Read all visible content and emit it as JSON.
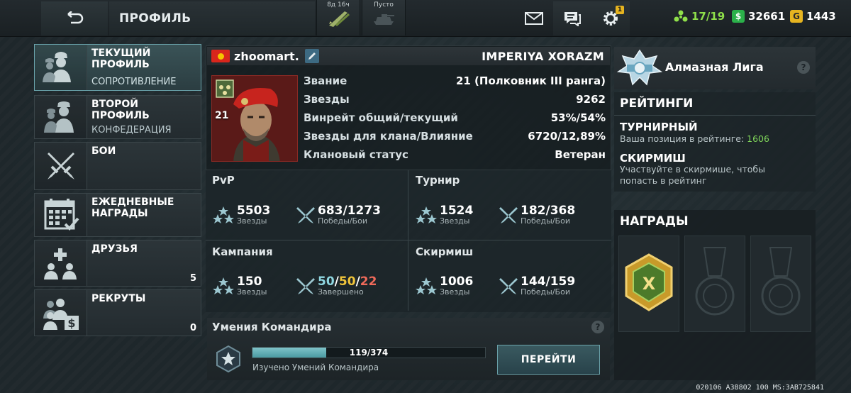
{
  "topbar": {
    "title": "ПРОФИЛЬ",
    "slot1_label": "8д 16ч",
    "slot2_label": "Пусто",
    "settings_badge": "1",
    "energy": "17/19",
    "silver": "32661",
    "gold": "1443",
    "colors": {
      "energy": "#8fe04a",
      "silver": "#2bb14a",
      "gold": "#e6b420"
    }
  },
  "sidebar": {
    "items": [
      {
        "title": "ТЕКУЩИЙ ПРОФИЛЬ",
        "sub": "СОПРОТИВЛЕНИЕ",
        "icon": "soldiers-icon"
      },
      {
        "title": "ВТОРОЙ ПРОФИЛЬ",
        "sub": "КОНФЕДЕРАЦИЯ",
        "icon": "soldier-icon"
      },
      {
        "title": "БОИ",
        "icon": "crossed-swords-icon"
      },
      {
        "title": "ЕЖЕДНЕВНЫЕ НАГРАДЫ",
        "icon": "calendar-icon"
      },
      {
        "title": "ДРУЗЬЯ",
        "count": "5",
        "icon": "friends-icon"
      },
      {
        "title": "РЕКРУТЫ",
        "count": "0",
        "icon": "recruits-icon"
      }
    ]
  },
  "profile": {
    "nickname": "zhoomart.",
    "clan": "IMPERIYA XORAZM",
    "rank_number": "21",
    "info": [
      {
        "k": "Звание",
        "v": "21 (Полковник III ранга)"
      },
      {
        "k": "Звезды",
        "v": "9262"
      },
      {
        "k": "Винрейт общий/текущий",
        "v": "53%/54%"
      },
      {
        "k": "Звезды для клана/Влияние",
        "v": "6720/12,89%"
      },
      {
        "k": "Клановый статус",
        "v": "Ветеран"
      }
    ]
  },
  "stats": {
    "pvp": {
      "title": "PvP",
      "stars": "5503",
      "stars_lbl": "Звезды",
      "wins": "683/1273",
      "wins_lbl": "Победы/Бои"
    },
    "tournament": {
      "title": "Турнир",
      "stars": "1524",
      "stars_lbl": "Звезды",
      "wins": "182/368",
      "wins_lbl": "Победы/Бои"
    },
    "campaign": {
      "title": "Кампания",
      "stars": "150",
      "stars_lbl": "Звезды",
      "done_a": "50",
      "done_sep1": "/",
      "done_b": "50",
      "done_sep2": "/",
      "done_c": "22",
      "done_lbl": "Завершено"
    },
    "skirmish": {
      "title": "Скирмиш",
      "stars": "1006",
      "stars_lbl": "Звезды",
      "wins": "144/159",
      "wins_lbl": "Победы/Бои"
    }
  },
  "skills": {
    "title": "Умения Командира",
    "progress_text": "119/374",
    "progress_fraction": 0.318,
    "caption": "Изучено Умений Командира",
    "button": "ПЕРЕЙТИ"
  },
  "right": {
    "league": "Алмазная Лига",
    "ratings_head": "РЕЙТИНГИ",
    "tourn_head": "ТУРНИРНЫЙ",
    "tourn_text": "Ваша позиция в рейтинге:",
    "tourn_pos": "1606",
    "skirm_head": "СКИРМИШ",
    "skirm_text": "Участвуйте в скирмише, чтобы попасть в рейтинг",
    "awards_head": "НАГРАДЫ",
    "award_letter": "X"
  },
  "footer": {
    "code": "020106 A38802 100 MS:3AB725841"
  }
}
